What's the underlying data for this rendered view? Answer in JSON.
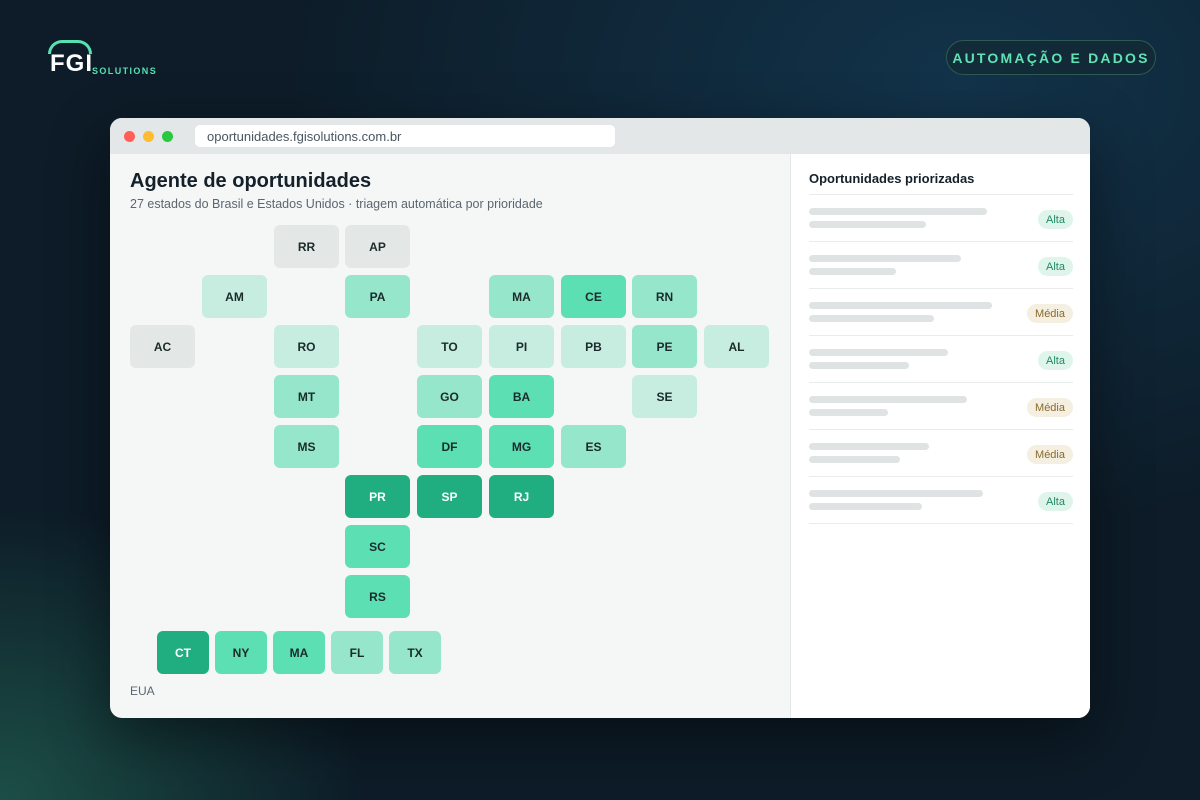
{
  "brand": {
    "name": "FGI",
    "sub": "SOLUTIONS",
    "accent": "#57e0b0"
  },
  "header_tag": "AUTOMAÇÃO E DADOS",
  "browser": {
    "url": "oportunidades.fgisolutions.com.br"
  },
  "main": {
    "title": "Agente de oportunidades",
    "subtitle": "27 estados do Brasil e Estados Unidos · triagem automática por prioridade",
    "us_label": "EUA"
  },
  "colors": {
    "level0": "#e3e8e6",
    "level1": "#c6ede0",
    "level2": "#95e6cb",
    "level3": "#5cdfb3",
    "level4": "#20ad7f"
  },
  "brazil_states": [
    {
      "code": "RR",
      "level": 0
    },
    {
      "code": "AP",
      "level": 0
    },
    {
      "code": "AM",
      "level": 1
    },
    {
      "code": "PA",
      "level": 2
    },
    {
      "code": "MA",
      "level": 2
    },
    {
      "code": "CE",
      "level": 3
    },
    {
      "code": "RN",
      "level": 2
    },
    {
      "code": "AC",
      "level": 0
    },
    {
      "code": "RO",
      "level": 1
    },
    {
      "code": "TO",
      "level": 1
    },
    {
      "code": "PI",
      "level": 1
    },
    {
      "code": "PB",
      "level": 1
    },
    {
      "code": "PE",
      "level": 2
    },
    {
      "code": "AL",
      "level": 1
    },
    {
      "code": "MT",
      "level": 2
    },
    {
      "code": "GO",
      "level": 2
    },
    {
      "code": "BA",
      "level": 3
    },
    {
      "code": "SE",
      "level": 1
    },
    {
      "code": "MS",
      "level": 2
    },
    {
      "code": "DF",
      "level": 3
    },
    {
      "code": "MG",
      "level": 3
    },
    {
      "code": "ES",
      "level": 2
    },
    {
      "code": "PR",
      "level": 4
    },
    {
      "code": "SP",
      "level": 4
    },
    {
      "code": "RJ",
      "level": 4
    },
    {
      "code": "SC",
      "level": 3
    },
    {
      "code": "RS",
      "level": 3
    }
  ],
  "us_states": [
    {
      "code": "CT",
      "level": 4
    },
    {
      "code": "NY",
      "level": 3
    },
    {
      "code": "MA",
      "level": 3
    },
    {
      "code": "FL",
      "level": 2
    },
    {
      "code": "TX",
      "level": 2
    }
  ],
  "panel": {
    "title": "Oportunidades priorizadas",
    "items": [
      {
        "priority": "Alta",
        "kind": "alta"
      },
      {
        "priority": "Alta",
        "kind": "alta"
      },
      {
        "priority": "Média",
        "kind": "media"
      },
      {
        "priority": "Alta",
        "kind": "alta"
      },
      {
        "priority": "Média",
        "kind": "media"
      },
      {
        "priority": "Média",
        "kind": "media"
      },
      {
        "priority": "Alta",
        "kind": "alta"
      }
    ]
  }
}
